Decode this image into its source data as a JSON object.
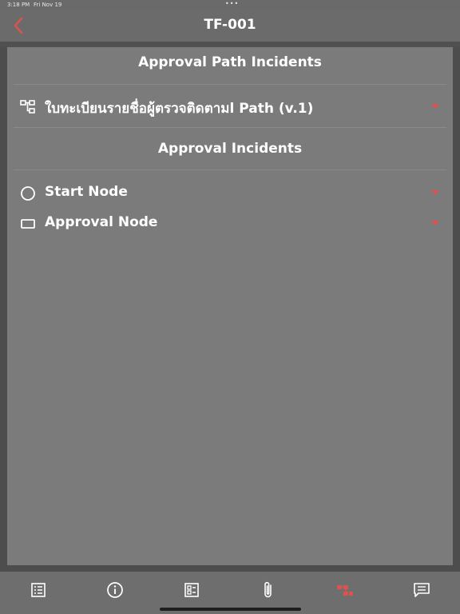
{
  "status_bar": {
    "time": "3:18 PM",
    "date": "Fri Nov 19",
    "dots": "•••"
  },
  "nav": {
    "title": "TF-001",
    "back_icon": "chevron-left-icon"
  },
  "sections": {
    "path_header": "Approval Path Incidents",
    "path_item": "ใบทะเบียนรายชื่อผู้ตรวจติดตามl Path (v.1)",
    "incidents_header": "Approval Incidents",
    "incident_items": [
      "Start Node",
      "Approval Node"
    ]
  },
  "tabs": [
    "list-icon",
    "info-icon",
    "checklist-icon",
    "paperclip-icon",
    "approval-path-icon",
    "comment-icon"
  ],
  "colors": {
    "accent": "#d9534f",
    "background": "#7b7b7b",
    "text": "#ffffff"
  }
}
